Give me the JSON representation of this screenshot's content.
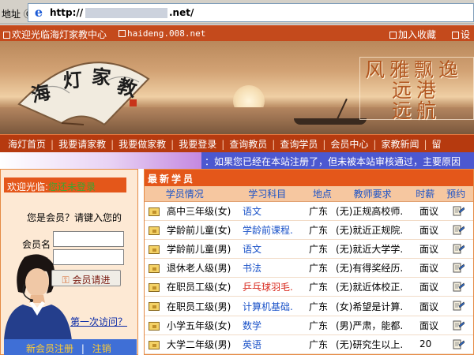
{
  "addressbar": {
    "label": "地址 ⓪",
    "url_prefix": "http://",
    "url_suffix": ".net/"
  },
  "topbar": {
    "welcome": "欢迎光临海灯家教中心",
    "domain": "haideng.008.net",
    "add_favorite": "加入收藏",
    "settings": "设"
  },
  "banner": {
    "fan_text": "海灯家教",
    "calligraphy": [
      "风雅飘逸",
      "远港",
      "远航"
    ]
  },
  "nav": {
    "items": [
      "海灯首页",
      "我要请家教",
      "我要做家教",
      "我要登录",
      "查询教员",
      "查询学员",
      "会员中心",
      "家教新闻",
      "留"
    ]
  },
  "marquee": {
    "text": "：如果您已经在本站注册了，但未被本站审核通过，主要原因"
  },
  "login": {
    "welcome_prefix": "欢迎光临:",
    "welcome_status": "您还未登录",
    "question": "您是会员？请键入您的",
    "username_label": "会员名",
    "password_label": "密码",
    "login_button": "会员请进",
    "first_visit": "第一次访问？",
    "register": "新会员注册",
    "register_sep": "|",
    "logout": "注销"
  },
  "students": {
    "title": "最新学员",
    "columns": [
      "学员情况",
      "学习科目",
      "地点",
      "教师要求",
      "时薪",
      "预约"
    ],
    "rows": [
      {
        "grade": "高中三年级(女)",
        "subject": "语文",
        "place": "广东",
        "requirement": "(无)正规高校师.",
        "pay": "面议",
        "subject_color": "#1a52c8"
      },
      {
        "grade": "学龄前儿童(女)",
        "subject": "学龄前课程.",
        "place": "广东",
        "requirement": "(无)就近正规院.",
        "pay": "面议",
        "subject_color": "#1a52c8"
      },
      {
        "grade": "学龄前儿童(男)",
        "subject": "语文",
        "place": "广东",
        "requirement": "(无)就近大学学.",
        "pay": "面议",
        "subject_color": "#1a52c8"
      },
      {
        "grade": "退休老人级(男)",
        "subject": "书法",
        "place": "广东",
        "requirement": "(无)有得奖经历.",
        "pay": "面议",
        "subject_color": "#1a52c8"
      },
      {
        "grade": "在职员工级(女)",
        "subject": "乒乓球羽毛.",
        "place": "广东",
        "requirement": "(无)就近体校正.",
        "pay": "面议",
        "subject_color": "#d8281c"
      },
      {
        "grade": "在职员工级(男)",
        "subject": "计算机基础.",
        "place": "广东",
        "requirement": "(女)希望是计算.",
        "pay": "面议",
        "subject_color": "#1a52c8"
      },
      {
        "grade": "小学五年级(女)",
        "subject": "数学",
        "place": "广东",
        "requirement": "(男)严肃，能都.",
        "pay": "面议",
        "subject_color": "#1a52c8"
      },
      {
        "grade": "大学二年级(男)",
        "subject": "英语",
        "place": "广东",
        "requirement": "(无)研究生以上.",
        "pay": "20",
        "subject_color": "#1a52c8"
      }
    ]
  },
  "colors": {
    "brand_orange": "#e4571a",
    "nav_red": "#b63a0f",
    "link_blue": "#1a52c8",
    "panel_bg": "#fde9d4"
  }
}
